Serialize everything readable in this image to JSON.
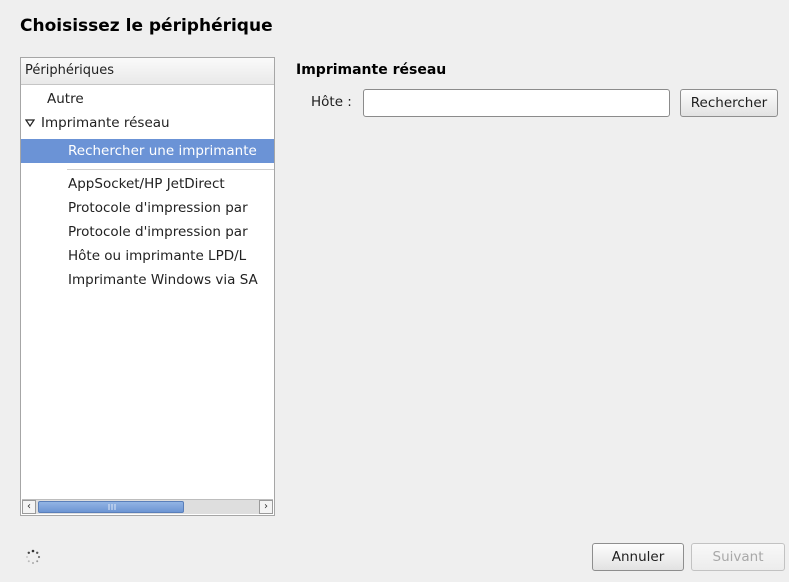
{
  "dialog": {
    "title": "Choisissez le périphérique"
  },
  "device_list": {
    "header": "Périphériques",
    "items": [
      {
        "label": "Autre",
        "level": 0,
        "expander": false,
        "selected": false
      },
      {
        "label": "Imprimante réseau",
        "level": 0,
        "expander": true,
        "expanded": true,
        "selected": false
      },
      {
        "label": "Rechercher une imprimante",
        "level": 1,
        "expander": false,
        "selected": true
      },
      {
        "label": "AppSocket/HP JetDirect",
        "level": 1,
        "expander": false,
        "selected": false
      },
      {
        "label": "Protocole d'impression par",
        "level": 1,
        "expander": false,
        "selected": false
      },
      {
        "label": "Protocole d'impression par",
        "level": 1,
        "expander": false,
        "selected": false
      },
      {
        "label": "Hôte ou imprimante LPD/L",
        "level": 1,
        "expander": false,
        "selected": false
      },
      {
        "label": "Imprimante Windows via SA",
        "level": 1,
        "expander": false,
        "selected": false
      }
    ],
    "scroll_left_icon": "chevron-left-icon",
    "scroll_right_icon": "chevron-right-icon"
  },
  "network_printer": {
    "title": "Imprimante réseau",
    "host_label": "Hôte :",
    "host_value": "",
    "search_button": "Rechercher"
  },
  "footer": {
    "spinner_icon": "spinner-icon",
    "cancel_button": "Annuler",
    "next_button": "Suivant"
  },
  "colors": {
    "selection": "#6b93d6",
    "background": "#efefef"
  }
}
